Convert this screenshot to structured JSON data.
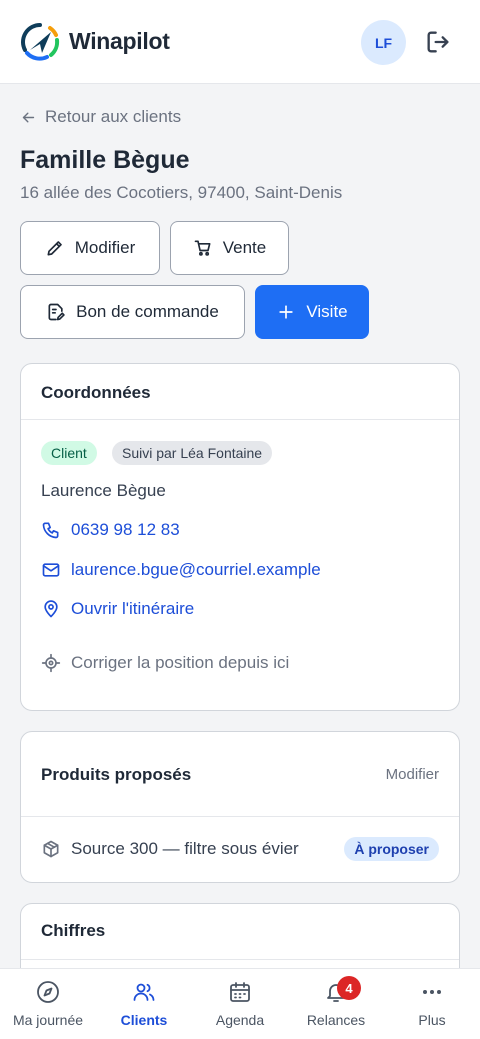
{
  "app": {
    "brand": "Winapilot",
    "user_initials": "LF"
  },
  "nav": {
    "back_label": "Retour aux clients"
  },
  "client": {
    "name": "Famille Bègue",
    "address": "16 allée des Cocotiers, 97400, Saint-Denis"
  },
  "actions": {
    "edit": "Modifier",
    "sale": "Vente",
    "order": "Bon de commande",
    "visit": "Visite"
  },
  "contact": {
    "title": "Coordonnées",
    "status_badge": "Client",
    "followed_badge": "Suivi par Léa Fontaine",
    "person": "Laurence Bègue",
    "phone": "0639 98 12 83",
    "email": "laurence.bgue@courriel.example",
    "route": "Ouvrir l'itinéraire",
    "fix_position": "Corriger la position depuis ici"
  },
  "products": {
    "title": "Produits proposés",
    "edit": "Modifier",
    "items": [
      {
        "name": "Source 300 — filtre sous évier",
        "status": "À proposer"
      }
    ]
  },
  "figures": {
    "title": "Chiffres"
  },
  "bottom_nav": {
    "items": [
      {
        "label": "Ma journée",
        "icon": "compass-icon"
      },
      {
        "label": "Clients",
        "icon": "users-icon"
      },
      {
        "label": "Agenda",
        "icon": "calendar-icon"
      },
      {
        "label": "Relances",
        "icon": "bell-icon",
        "badge": "4"
      },
      {
        "label": "Plus",
        "icon": "more-icon"
      }
    ]
  },
  "colors": {
    "primary": "#1e6ef4",
    "link": "#1d4ed8",
    "danger": "#dc2626"
  }
}
